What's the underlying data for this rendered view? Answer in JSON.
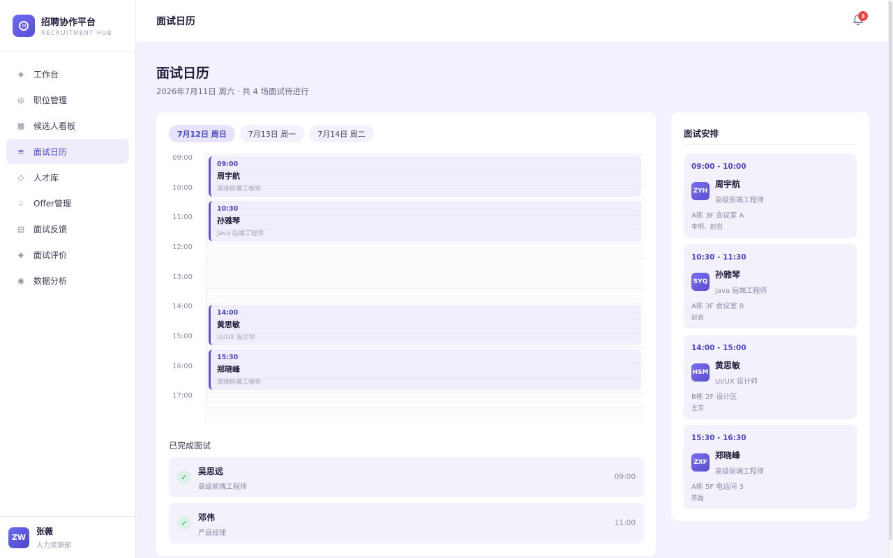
{
  "brand": {
    "title": "招聘协作平台",
    "subtitle": "RECRUITMENT HUB"
  },
  "sidebar": {
    "items": [
      {
        "label": "工作台",
        "icon": "diamond-icon"
      },
      {
        "label": "职位管理",
        "icon": "target-icon"
      },
      {
        "label": "候选人看板",
        "icon": "grid-icon"
      },
      {
        "label": "面试日历",
        "icon": "list-icon",
        "active": true
      },
      {
        "label": "人才库",
        "icon": "diamond-outline-icon"
      },
      {
        "label": "Offer管理",
        "icon": "spade-icon"
      },
      {
        "label": "面试反馈",
        "icon": "grid-icon"
      },
      {
        "label": "面试评价",
        "icon": "diamond-icon"
      },
      {
        "label": "数据分析",
        "icon": "dot-circle-icon"
      }
    ]
  },
  "user": {
    "initials": "ZW",
    "name": "张薇",
    "dept": "人力资源部"
  },
  "header": {
    "title": "面试日历",
    "notification_count": "3"
  },
  "page": {
    "title": "面试日历",
    "subtitle": "2026年7月11日 周六 · 共 4 场面试待进行"
  },
  "date_tabs": [
    "7月12日 周日",
    "7月13日 周一",
    "7月14日 周二"
  ],
  "timeline": {
    "hours": [
      "09:00",
      "10:00",
      "11:00",
      "12:00",
      "13:00",
      "14:00",
      "15:00",
      "16:00",
      "17:00"
    ],
    "events": [
      {
        "time": "09:00",
        "name": "周宇航",
        "role": "高级前端工程师"
      },
      {
        "time": "10:30",
        "name": "孙雅琴",
        "role": "Java 后端工程师"
      },
      {
        "time": "14:00",
        "name": "黄思敏",
        "role": "UI/UX 设计师"
      },
      {
        "time": "15:30",
        "name": "郑晓峰",
        "role": "高级前端工程师"
      }
    ]
  },
  "completed": {
    "title": "已完成面试",
    "items": [
      {
        "name": "吴思远",
        "role": "高级前端工程师",
        "time": "09:00"
      },
      {
        "name": "邓伟",
        "role": "产品经理",
        "time": "11:00"
      }
    ]
  },
  "schedule": {
    "title": "面试安排",
    "items": [
      {
        "time": "09:00 - 10:00",
        "initials": "ZYH",
        "name": "周宇航",
        "role": "高级前端工程师",
        "room": "A栋 3F 会议室 A",
        "people": "李明、赵岩"
      },
      {
        "time": "10:30 - 11:30",
        "initials": "SYQ",
        "name": "孙雅琴",
        "role": "Java 后端工程师",
        "room": "A栋 3F 会议室 B",
        "people": "赵岩"
      },
      {
        "time": "14:00 - 15:00",
        "initials": "HSM",
        "name": "黄思敏",
        "role": "UI/UX 设计师",
        "room": "B栋 2F 设计区",
        "people": "王芳"
      },
      {
        "time": "15:30 - 16:30",
        "initials": "ZXF",
        "name": "郑晓峰",
        "role": "高级前端工程师",
        "room": "A栋 5F 电话间 3",
        "people": "陈磊"
      }
    ]
  },
  "colors": {
    "accent": "#4b45c8",
    "success": "#19a36a",
    "badge": "#ee4444"
  }
}
